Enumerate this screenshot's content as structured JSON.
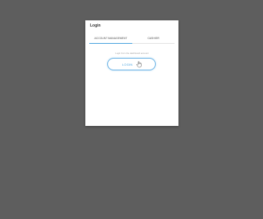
{
  "dialog": {
    "title": "Login"
  },
  "tabs": [
    {
      "label": "ACCOUNT MANAGEMENT",
      "active": true
    },
    {
      "label": "CASHIER",
      "active": false
    }
  ],
  "hint": "Login from the dashboard account",
  "login_button": {
    "label": "LOGIN",
    "icon": "hand-pointer-icon"
  },
  "colors": {
    "backdrop": "#5e5e5e",
    "accent": "#4aa3df"
  }
}
